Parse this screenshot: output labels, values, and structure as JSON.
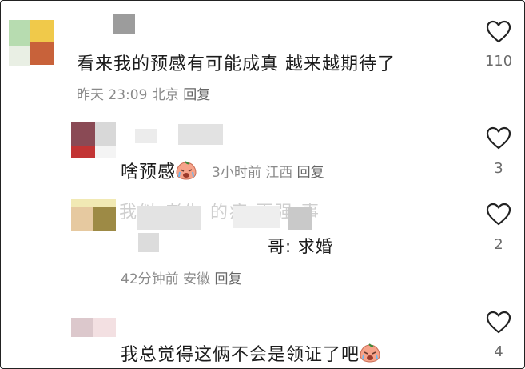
{
  "comments": [
    {
      "text": "看来我的预感有可能成真 越来越期待了",
      "time": "昨天 23:09",
      "location": "北京",
      "reply": "回复",
      "likes": "110"
    }
  ],
  "replies": [
    {
      "text": "啥预感",
      "emoji": "crying-emoji",
      "time": "3小时前",
      "location": "江西",
      "reply": "回复",
      "likes": "3"
    },
    {
      "text": "哥: 求婚",
      "time": "42分钟前",
      "location": "安徽",
      "reply": "回复",
      "likes": "2"
    },
    {
      "text": "我总觉得这俩不会是领证了吧",
      "emoji": "crying-emoji",
      "likes": "4"
    }
  ],
  "icons": {
    "like": "heart-icon",
    "emoji": "crying-emoji-icon"
  },
  "colors": {
    "text": "#1c1c1c",
    "meta": "#8a8a8a",
    "count": "#6b6b6b"
  }
}
